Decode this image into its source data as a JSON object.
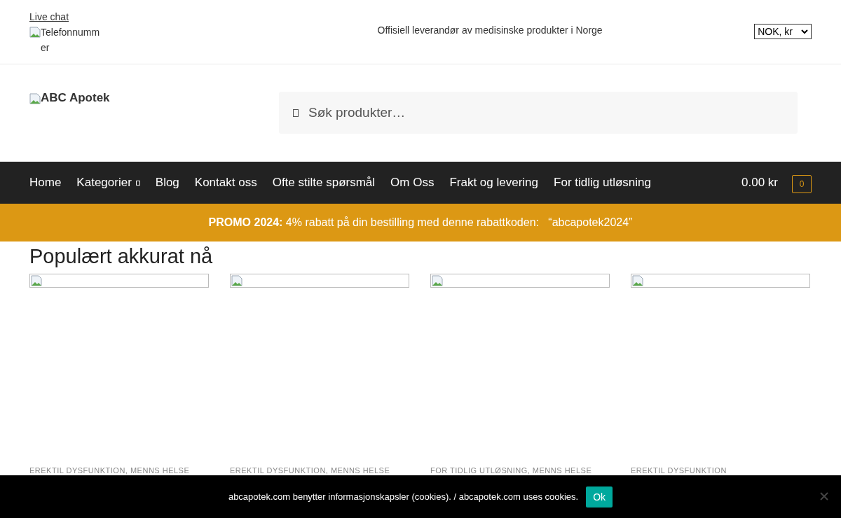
{
  "top_bar": {
    "live_chat": "Live chat",
    "phone_image_alt": "Telefonnummer",
    "tagline": "Offisiell leverandør av medisinske produkter i Norge",
    "currency": "NOK, kr"
  },
  "header": {
    "logo_alt": "ABC Apotek",
    "search": {
      "placeholder": "Søk produkter…"
    }
  },
  "nav": {
    "items": [
      {
        "label": "Home",
        "kind": "link"
      },
      {
        "label": "Kategorier",
        "kind": "dropdown"
      },
      {
        "label": "Blog",
        "kind": "link"
      },
      {
        "label": "Kontakt oss",
        "kind": "link"
      },
      {
        "label": "Ofte stilte spørsmål",
        "kind": "link"
      },
      {
        "label": "Om Oss",
        "kind": "link"
      },
      {
        "label": "Frakt og levering",
        "kind": "link"
      },
      {
        "label": "For tidlig utløsning",
        "kind": "link"
      }
    ],
    "cart_total": "0.00 kr",
    "cart_count": "0"
  },
  "promo": {
    "text": "**PROMO 2024:** 4% rabatt på din bestilling med denne rabattkoden:   “abcapotek2024”"
  },
  "section": {
    "title": "Populært akkurat nå",
    "products": [
      {
        "categories": "EREKTIL DYSFUNKTION, MENNS HELSE"
      },
      {
        "categories": "EREKTIL DYSFUNKTION, MENNS HELSE"
      },
      {
        "categories": "FOR TIDLIG UTLØSNING, MENNS HELSE"
      },
      {
        "categories": "EREKTIL DYSFUNKTION"
      }
    ]
  },
  "cookie_notice": {
    "text": "abcapotek.com benytter informasjonskapsler (cookies). / abcapotek.com uses cookies.",
    "button": "Ok"
  }
}
